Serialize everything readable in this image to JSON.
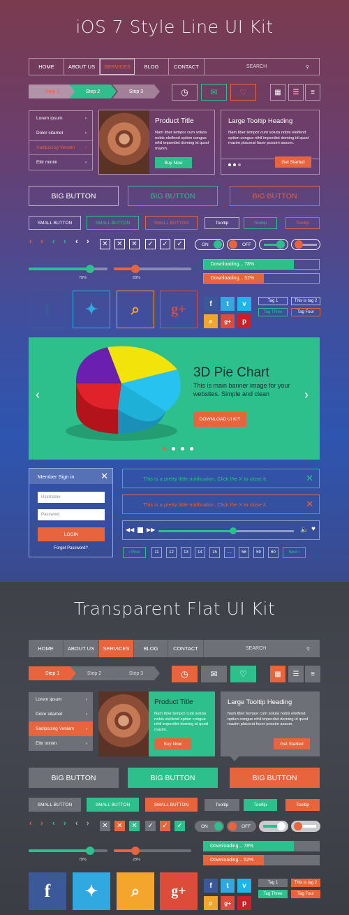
{
  "kit1": {
    "title": "iOS 7 Style Line UI Kit",
    "nav": [
      "HOME",
      "ABOUT US",
      "SERVICES",
      "BLOG",
      "CONTACT"
    ],
    "search_placeholder": "SEARCH",
    "steps": [
      "Step 1",
      "Step 2",
      "Step 3"
    ],
    "menu": [
      "Lorem ipsum",
      "Dolor sitamet",
      "Sadipscing Veniam",
      "Elitr minim"
    ],
    "card": {
      "title": "Product Title",
      "body": "Nam liber tempor cum soluta nobis eleifend option congue nihil imperdiet doming id quod mazim.",
      "button": "Buy Now"
    },
    "tooltip": {
      "title": "Large Tooltip Heading",
      "body": "Nam liber tempor cum soluta nobis eleifend option congue nihil imperdiet doming id quod mazim placerat facer possim assum.",
      "button": "Get Started"
    },
    "big_buttons": [
      "BIG BUTTON",
      "BIG BUTTON",
      "BIG BUTTON"
    ],
    "small_buttons": [
      "SMALL BUTTON",
      "SMALL BUTTON",
      "SMALL BUTTON"
    ],
    "tooltips": [
      "Tooltip",
      "Tooltip",
      "Tooltip"
    ],
    "toggles": {
      "on": "ON",
      "off": "OFF"
    },
    "sliders": [
      {
        "label": "78%",
        "value": 0.78
      },
      {
        "label": "28%",
        "value": 0.28
      }
    ],
    "downloads": [
      {
        "label": "Downloading... 78%",
        "value": 0.78
      },
      {
        "label": "Downloading... 52%",
        "value": 0.52
      }
    ],
    "tags": [
      "Tag 1",
      "This is tag 2",
      "Tag Three",
      "Tag Four"
    ],
    "banner": {
      "title": "3D Pie Chart",
      "text": "This is main banner image for your websites. Simple and clean",
      "button": "DOWNLOAD UI KIT"
    },
    "signin": {
      "title": "Member Sign in",
      "username": "Username",
      "password": "Password",
      "button": "LOGIN",
      "forgot": "Forget Password?"
    },
    "notifications": [
      "This is a pretty little notification. Click the X to close it.",
      "This is a pretty little notification. Click the X to close it."
    ],
    "player_progress": 0.55,
    "pagination": [
      "Prev",
      "11",
      "12",
      "13",
      "14",
      "15",
      "....",
      "58",
      "59",
      "60",
      "Next"
    ]
  },
  "kit2": {
    "title": "Transparent Flat UI Kit",
    "nav": [
      "HOME",
      "ABOUT US",
      "SERVICES",
      "BLOG",
      "CONTACT"
    ],
    "search_placeholder": "SEARCH",
    "steps": [
      "Step 1",
      "Step 2",
      "Step 3"
    ],
    "menu": [
      "Lorem ipsum",
      "Dolor sitamet",
      "Sadipscing Veniam",
      "Elitr minim"
    ],
    "card": {
      "title": "Product Title",
      "body": "Nam liber tempor cum soluta nobis eleifend option congue nihil imperdiet doming id quod mazim.",
      "button": "Buy Now"
    },
    "tooltip": {
      "title": "Large Tooltip Heading",
      "body": "Nam liber tempor cum soluta nobis eleifend option congue nihil imperdiet doming id quod mazim placerat facer possim assum.",
      "button": "Get Started"
    },
    "big_buttons": [
      "BIG BUTTON",
      "BIG BUTTON",
      "BIG BUTTON"
    ],
    "small_buttons": [
      "SMALL BUTTON",
      "SMALL BUTTON",
      "SMALL BUTTON"
    ],
    "tooltips": [
      "Tooltip",
      "Tooltip",
      "Tooltip"
    ],
    "toggles": {
      "on": "ON",
      "off": "OFF"
    },
    "sliders": [
      {
        "label": "78%",
        "value": 0.78
      },
      {
        "label": "28%",
        "value": 0.28
      }
    ],
    "downloads": [
      {
        "label": "Downloading... 78%",
        "value": 0.78
      },
      {
        "label": "Downloading... 52%",
        "value": 0.52
      }
    ],
    "tags": [
      "Tag 1",
      "This is tag 2",
      "Tag Three",
      "Tag Four"
    ]
  },
  "colors": {
    "green": "#2dc08d",
    "orange": "#e8643c",
    "facebook": "#3b5998",
    "twitter": "#2fa9e0",
    "rss": "#f4a52c",
    "gplus": "#dd4b39",
    "pinterest": "#cb2027",
    "vimeo": "#1ab7ea"
  },
  "icons": [
    "search-icon",
    "clock-icon",
    "inbox-icon",
    "heart-icon",
    "grid-icon",
    "list-icon",
    "menu-icon",
    "chevron-right-icon",
    "check-icon",
    "close-icon",
    "facebook-icon",
    "twitter-icon",
    "rss-icon",
    "gplus-icon",
    "vimeo-icon",
    "pinterest-icon",
    "play-icon",
    "stop-icon",
    "forward-icon",
    "rewind-icon",
    "volume-icon"
  ]
}
